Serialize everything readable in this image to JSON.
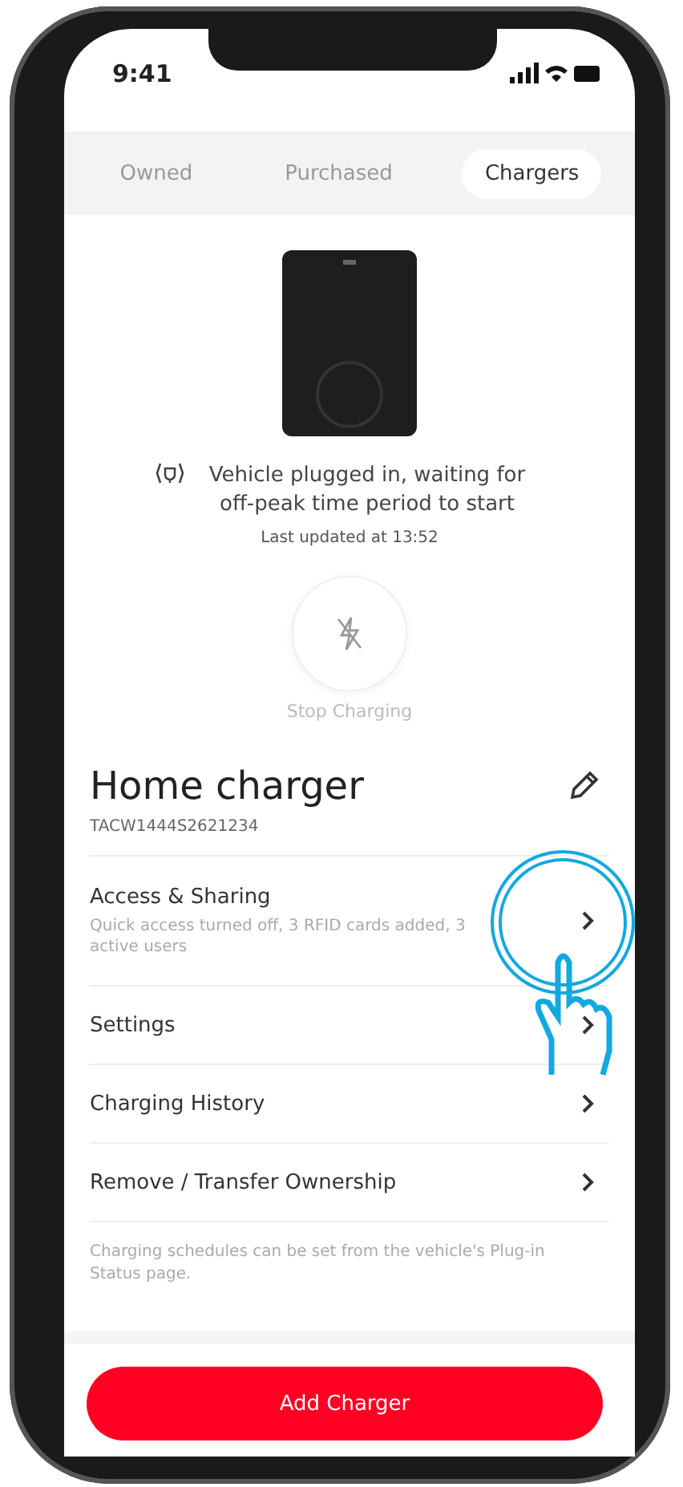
{
  "status_bar": {
    "time": "9:41"
  },
  "tabs": [
    {
      "label": "Owned",
      "selected": false
    },
    {
      "label": "Purchased",
      "selected": false
    },
    {
      "label": "Chargers",
      "selected": true
    }
  ],
  "charger": {
    "status": "Vehicle plugged in, waiting for off-peak time period to start",
    "updated": "Last updated at 13:52",
    "action": "Stop Charging"
  },
  "name": "Home charger",
  "serial": "TACW1444S2621234",
  "menu": [
    {
      "label": "Access & Sharing",
      "detail": "Quick access turned off, 3 RFID cards added, 3 active users"
    },
    {
      "label": "Settings"
    },
    {
      "label": "Charging History"
    },
    {
      "label": "Remove / Transfer Ownership"
    }
  ],
  "note": "Charging schedules can be set from the vehicle's Plug-in Status page.",
  "primary_button": "Add Charger"
}
